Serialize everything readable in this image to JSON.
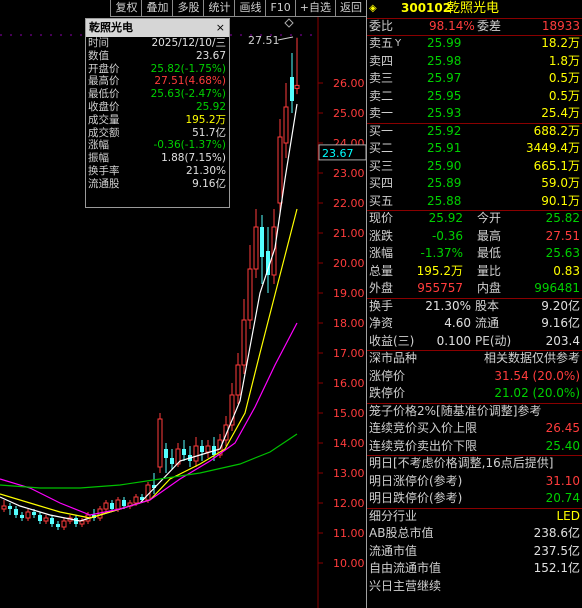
{
  "toolbar": [
    "复权",
    "叠加",
    "多股",
    "统计",
    "画线",
    "F10",
    "+自选",
    "返回"
  ],
  "chart": {
    "top_price_tag": "27.51",
    "current_price_tag": "23.67",
    "price_labels": [
      "26.00",
      "25.00",
      "24.00",
      "23.00",
      "22.00",
      "21.00",
      "20.00",
      "19.00",
      "18.00",
      "17.00",
      "16.00",
      "15.00",
      "14.00",
      "13.00",
      "12.00",
      "11.00",
      "10.00"
    ]
  },
  "popup": {
    "title": "乾照光电",
    "close": "×",
    "rows": [
      {
        "label": "时间",
        "value": "2025/12/10/三",
        "color": "white"
      },
      {
        "label": "数值",
        "value": "23.67",
        "color": "white"
      },
      {
        "label": "开盘价",
        "value": "25.82(-1.75%)",
        "color": "green"
      },
      {
        "label": "最高价",
        "value": "27.51(4.68%)",
        "color": "red"
      },
      {
        "label": "最低价",
        "value": "25.63(-2.47%)",
        "color": "green"
      },
      {
        "label": "收盘价",
        "value": "25.92",
        "color": "green"
      },
      {
        "label": "成交量",
        "value": "195.2万",
        "color": "yellow"
      },
      {
        "label": "成交额",
        "value": "51.7亿",
        "color": "white"
      },
      {
        "label": "涨幅",
        "value": "-0.36(-1.37%)",
        "color": "green"
      },
      {
        "label": "振幅",
        "value": "1.88(7.15%)",
        "color": "white"
      },
      {
        "label": "换手率",
        "value": "21.30%",
        "color": "white"
      },
      {
        "label": "流通股",
        "value": "9.16亿",
        "color": "white"
      }
    ]
  },
  "header": {
    "code": "300102",
    "name": "乾照光电"
  },
  "weibi": {
    "label1": "委比",
    "val1": "98.14%",
    "label2": "委差",
    "val2": "18933"
  },
  "asks": [
    {
      "label": "卖五",
      "mark": "Y",
      "price": "25.99",
      "vol": "18.2万"
    },
    {
      "label": "卖四",
      "mark": "",
      "price": "25.98",
      "vol": "1.8万"
    },
    {
      "label": "卖三",
      "mark": "",
      "price": "25.97",
      "vol": "0.5万"
    },
    {
      "label": "卖二",
      "mark": "",
      "price": "25.95",
      "vol": "0.5万"
    },
    {
      "label": "卖一",
      "mark": "",
      "price": "25.93",
      "vol": "25.4万"
    }
  ],
  "bids": [
    {
      "label": "买一",
      "price": "25.92",
      "vol": "688.2万"
    },
    {
      "label": "买二",
      "price": "25.91",
      "vol": "3449.4万"
    },
    {
      "label": "买三",
      "price": "25.90",
      "vol": "665.1万"
    },
    {
      "label": "买四",
      "price": "25.89",
      "vol": "59.0万"
    },
    {
      "label": "买五",
      "price": "25.88",
      "vol": "90.1万"
    }
  ],
  "quote": [
    {
      "l1": "现价",
      "v1": "25.92",
      "c1": "green",
      "l2": "今开",
      "v2": "25.82",
      "c2": "green"
    },
    {
      "l1": "涨跌",
      "v1": "-0.36",
      "c1": "green",
      "l2": "最高",
      "v2": "27.51",
      "c2": "red"
    },
    {
      "l1": "涨幅",
      "v1": "-1.37%",
      "c1": "green",
      "l2": "最低",
      "v2": "25.63",
      "c2": "green"
    },
    {
      "l1": "总量",
      "v1": "195.2万",
      "c1": "yellow",
      "l2": "量比",
      "v2": "0.83",
      "c2": "yellow"
    },
    {
      "l1": "外盘",
      "v1": "955757",
      "c1": "red",
      "l2": "内盘",
      "v2": "996481",
      "c2": "green"
    }
  ],
  "finance": [
    {
      "l1": "换手",
      "v1": "21.30%",
      "l2": "股本",
      "v2": "9.20亿"
    },
    {
      "l1": "净资",
      "v1": "4.60",
      "l2": "流通",
      "v2": "9.16亿"
    },
    {
      "l1": "收益(三)",
      "v1": "0.100",
      "l2": "PE(动)",
      "v2": "203.4"
    }
  ],
  "limits_header": {
    "left": "深市品种",
    "right": "相关数据仅供参考"
  },
  "limits": [
    {
      "label": "涨停价",
      "value": "31.54 (20.0%)",
      "color": "red"
    },
    {
      "label": "跌停价",
      "value": "21.02 (20.0%)",
      "color": "green"
    }
  ],
  "auction_header": "笼子价格2%[随基准价调整]参考",
  "auction": [
    {
      "label": "连续竞价买入价上限",
      "value": "26.45",
      "color": "red"
    },
    {
      "label": "连续竞价卖出价下限",
      "value": "25.40",
      "color": "green"
    }
  ],
  "tomorrow_header": "明日[不考虑价格调整,16点后提供]",
  "tomorrow": [
    {
      "label": "明日涨停价(参考)",
      "value": "31.10",
      "color": "red"
    },
    {
      "label": "明日跌停价(参考)",
      "value": "20.74",
      "color": "green"
    }
  ],
  "industry": {
    "label": "细分行业",
    "value": "LED"
  },
  "caps": [
    {
      "label": "AB股总市值",
      "value": "238.6亿"
    },
    {
      "label": "流通市值",
      "value": "237.5亿"
    },
    {
      "label": "自由流通市值",
      "value": "152.1亿"
    },
    {
      "label": "兴日主营继续",
      "value": ""
    }
  ],
  "colors": {
    "up": "#ff3c3c",
    "down": "#54ffff",
    "ma5": "#ffffff",
    "ma10": "#ffff00",
    "ma20": "#ff00ff",
    "ma60": "#00c000",
    "grid": "#8a0000"
  }
}
